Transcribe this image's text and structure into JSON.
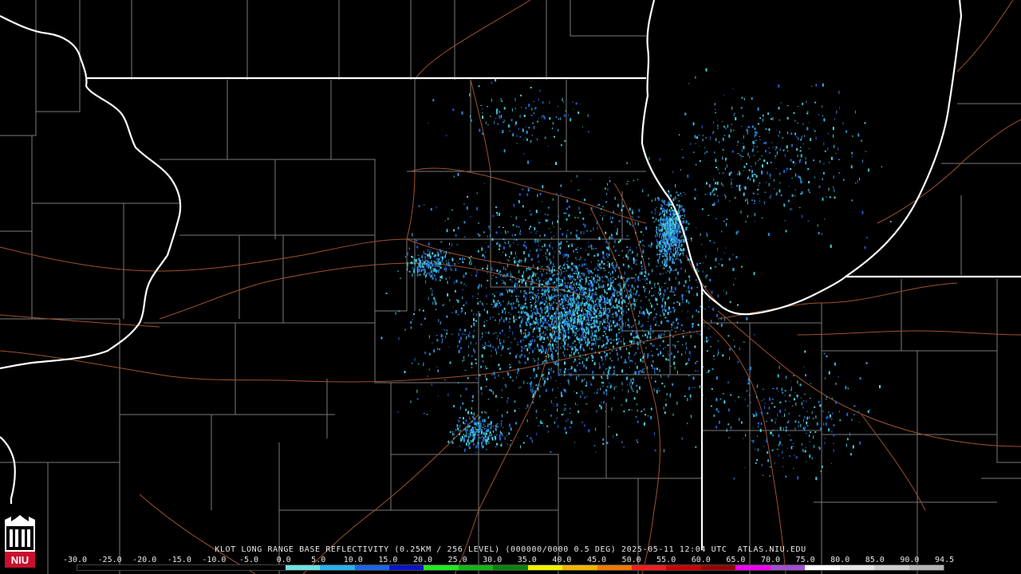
{
  "product_title": "KLOT LONG RANGE BASE REFLECTIVITY (0.25KM / 256 LEVEL) (000000/0000 0.5 DEG) 2025-05-11 12:04 UTC  ATLAS.NIU.EDU",
  "logo_text": "NIU",
  "background_color": "#000000",
  "state_border_color": "#ffffff",
  "county_line_color": "#8a8a8a",
  "road_color": "#a0522d",
  "echo_colors": [
    "#2e8fd8",
    "#38b8d0",
    "#1f5fd0",
    "#4fd2e0"
  ],
  "scale": {
    "labels": [
      "-30.0",
      "-25.0",
      "-20.0",
      "-15.0",
      "-10.0",
      "-5.0",
      "0.0",
      "5.0",
      "10.0",
      "15.0",
      "20.0",
      "25.0",
      "30.0",
      "35.0",
      "40.0",
      "45.0",
      "50.0",
      "55.0",
      "60.0",
      "65.0",
      "70.0",
      "75.0",
      "80.0",
      "85.0",
      "90.0",
      "94.5"
    ],
    "colors": [
      "#000000",
      "#000000",
      "#000000",
      "#000000",
      "#000000",
      "#000000",
      "#6ee0e0",
      "#2ab0e8",
      "#1e64e8",
      "#0a14c8",
      "#22e822",
      "#16b416",
      "#0a820a",
      "#f0f000",
      "#f0b400",
      "#f07800",
      "#f01e1e",
      "#c80000",
      "#960000",
      "#f000f0",
      "#a050d0",
      "#ffffff",
      "#e6e6e6",
      "#cccccc",
      "#b4b4b4"
    ]
  }
}
